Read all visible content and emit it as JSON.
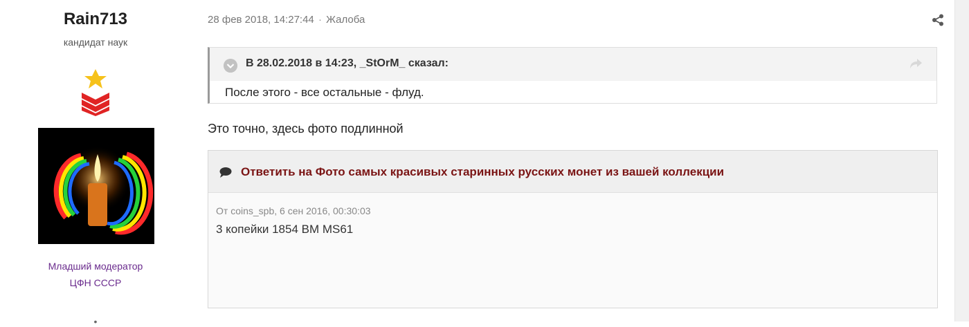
{
  "author": {
    "name": "Rain713",
    "rank": "кандидат наук",
    "group_line1": "Младший модератор",
    "group_line2": "ЦФН СССР",
    "extra": "•",
    "group_color": "#6a2b8d"
  },
  "post": {
    "date": "28 фев 2018, 14:27:44",
    "separator": "·",
    "report_label": "Жалоба",
    "text": "Это точно, здесь фото подлинной"
  },
  "quote": {
    "citation": "В 28.02.2018 в 14:23, _StOrM_ сказал:",
    "text": "После этого - все остальные - флуд."
  },
  "embed": {
    "title": "Ответить на Фото самых красивых старинных русских монет из вашей коллекции",
    "from": "От coins_spb, 6 сен 2016, 00:30:03",
    "text": "3 копейки 1854 ВМ MS61",
    "title_color": "#7a1414"
  },
  "icons": {
    "share": "share-icon",
    "quote_toggle": "chevron-down-icon",
    "quote_goto": "forward-arrow-icon",
    "embed": "chat-bubble-icon"
  }
}
